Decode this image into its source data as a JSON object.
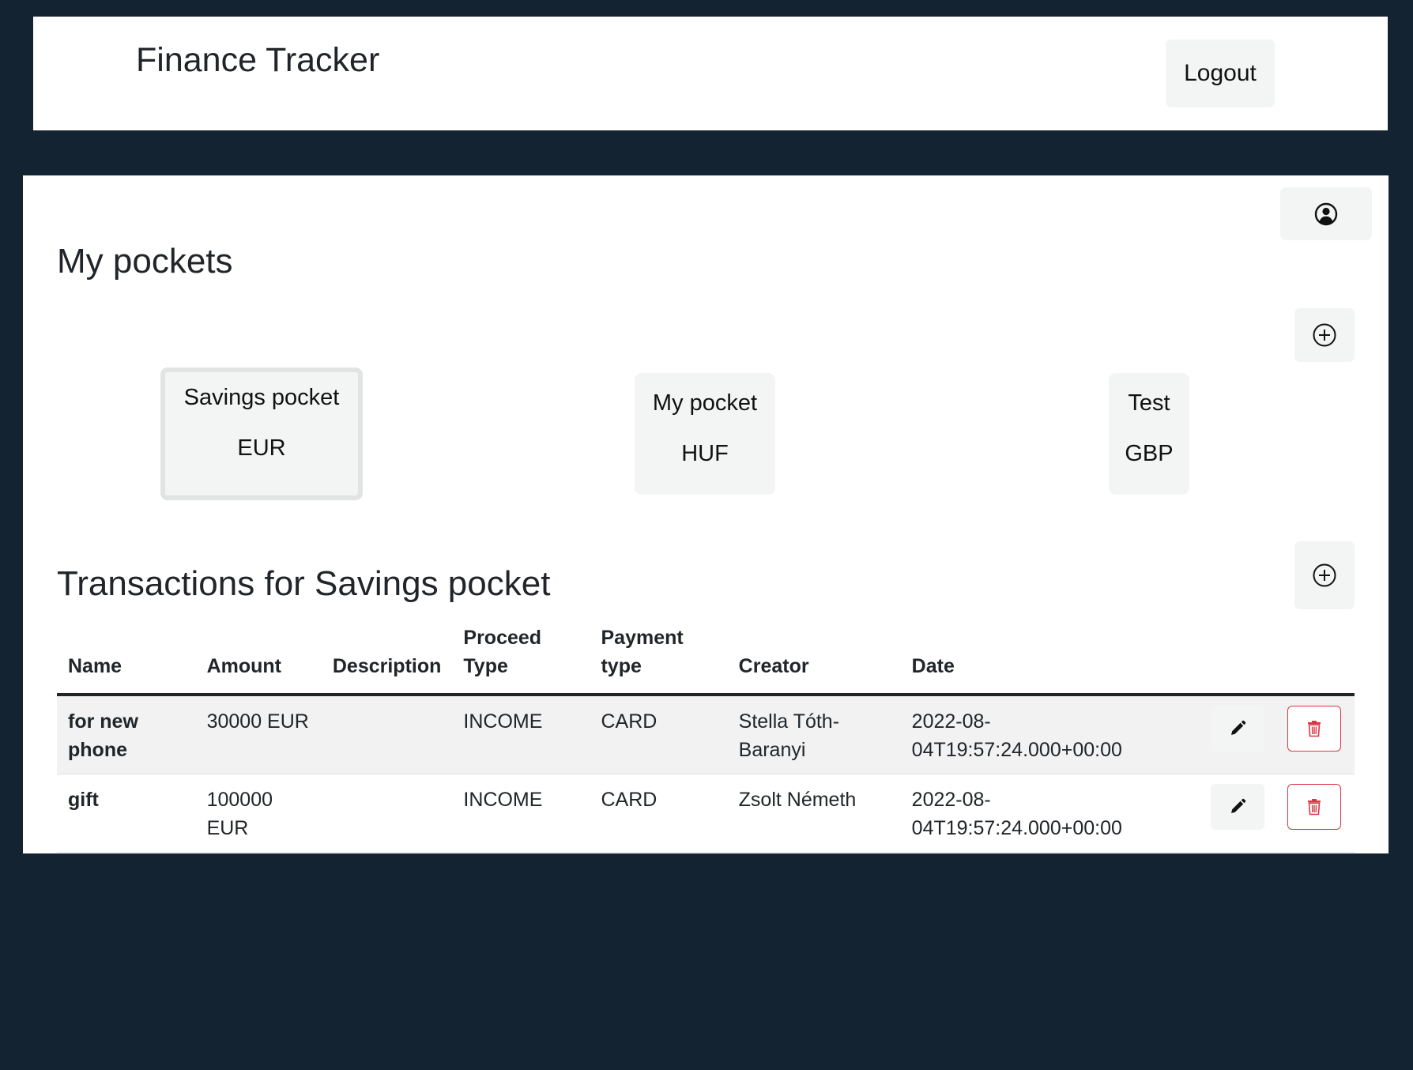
{
  "header": {
    "title": "Finance Tracker",
    "logout_label": "Logout"
  },
  "pockets": {
    "heading": "My pockets",
    "items": [
      {
        "name": "Savings pocket",
        "currency": "EUR",
        "selected": true
      },
      {
        "name": "My pocket",
        "currency": "HUF",
        "selected": false
      },
      {
        "name": "Test",
        "currency": "GBP",
        "selected": false
      }
    ]
  },
  "transactions": {
    "heading": "Transactions for Savings pocket",
    "columns": {
      "name": "Name",
      "amount": "Amount",
      "description": "Description",
      "proceed_type": "Proceed Type",
      "payment_type": "Payment type",
      "creator": "Creator",
      "date": "Date"
    },
    "rows": [
      {
        "name": "for new phone",
        "amount": "30000 EUR",
        "description": "",
        "proceed_type": "INCOME",
        "payment_type": "CARD",
        "creator": "Stella Tóth-Baranyi",
        "date": "2022-08-04T19:57:24.000+00:00"
      },
      {
        "name": "gift",
        "amount": "100000 EUR",
        "description": "",
        "proceed_type": "INCOME",
        "payment_type": "CARD",
        "creator": "Zsolt Németh",
        "date": "2022-08-04T19:57:24.000+00:00"
      }
    ]
  },
  "icons": {
    "profile": "user-circle-icon",
    "add": "plus-circle-icon",
    "edit": "pencil-icon",
    "delete": "trash-icon"
  },
  "colors": {
    "page_background": "#132332",
    "panel_background": "#ffffff",
    "button_background": "#f3f4f4",
    "delete_accent": "#dc3545"
  }
}
